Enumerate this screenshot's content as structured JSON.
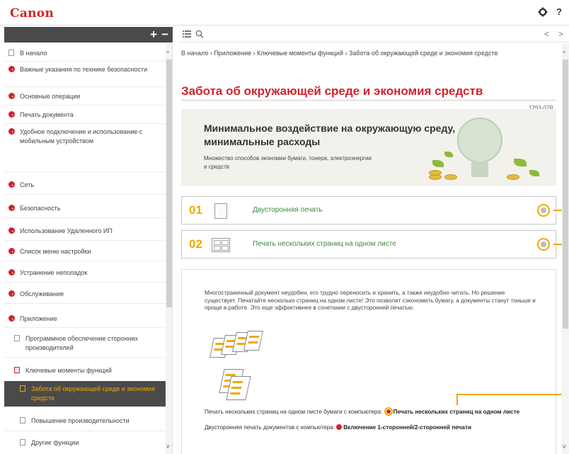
{
  "header": {
    "logo": "Canon",
    "help_label": "?"
  },
  "toolbar": {
    "expand_label": "+",
    "collapse_label": "−",
    "nav_prev": "<",
    "nav_next": ">"
  },
  "sidebar": {
    "items": [
      {
        "label": "В начало",
        "type": "page"
      },
      {
        "label": "Важные указания по технике безопасности",
        "type": "chapter"
      },
      {
        "label": "Основные операции",
        "type": "chapter"
      },
      {
        "label": "Печать документа",
        "type": "chapter"
      },
      {
        "label": "Удобное подключение и использование с мобильным устройством",
        "type": "chapter"
      },
      {
        "label": "Сеть",
        "type": "chapter"
      },
      {
        "label": "Безопасность",
        "type": "chapter"
      },
      {
        "label": "Использование Удаленного ИП",
        "type": "chapter"
      },
      {
        "label": "Список меню настройки",
        "type": "chapter"
      },
      {
        "label": "Устранение неполадок",
        "type": "chapter"
      },
      {
        "label": "Обслуживание",
        "type": "chapter"
      },
      {
        "label": "Приложение",
        "type": "chapter"
      },
      {
        "label": "Программное обеспечение сторонних производителей",
        "type": "page"
      },
      {
        "label": "Ключевые моменты функций",
        "type": "page"
      },
      {
        "label": "Забота об окружающей среде и экономия средств",
        "type": "page"
      },
      {
        "label": "Повышение производительности",
        "type": "page"
      },
      {
        "label": "Другие функции",
        "type": "page"
      }
    ]
  },
  "breadcrumb": "В начало › Приложение › Ключевые моменты функций › Забота об окружающей среде и экономия средств",
  "page_title": "Забота об окружающей среде и экономия средств",
  "doc_id": "1293-07R",
  "banner": {
    "title": "Минимальное воздействие на окружающую среду, минимальные расходы",
    "subtitle": "Множество способов экономии бумаги, тонера, электроэнергии и средств"
  },
  "cards": [
    {
      "num": "01",
      "label": "Двусторонняя печать"
    },
    {
      "num": "02",
      "label": "Печать нескольких страниц на одном листе"
    }
  ],
  "panel": {
    "description": "Многостраничный документ неудобен, его трудно переносить и хранить, а также неудобно читать. Но решение существует. Печатайте несколько страниц на одном листе! Это позволит сэкономить бумагу, а документы станут тоньше и проще в работе. Это еще эффективнее в сочетании с двусторонней печатью.",
    "line1_text": "Печать нескольких страниц на одном листе бумаги с компьютера:",
    "line1_link": "Печать нескольких страниц на одном листе",
    "line2_text": "Двусторонняя печать документов с компьютера:",
    "line2_link": "Включение 1-сторонней/2-сторонней печати"
  },
  "colors": {
    "brand_red": "#d2232a",
    "accent_orange": "#f0a800",
    "link_green": "#3c8a3c",
    "sidebar_dark": "#4a4a4a"
  }
}
